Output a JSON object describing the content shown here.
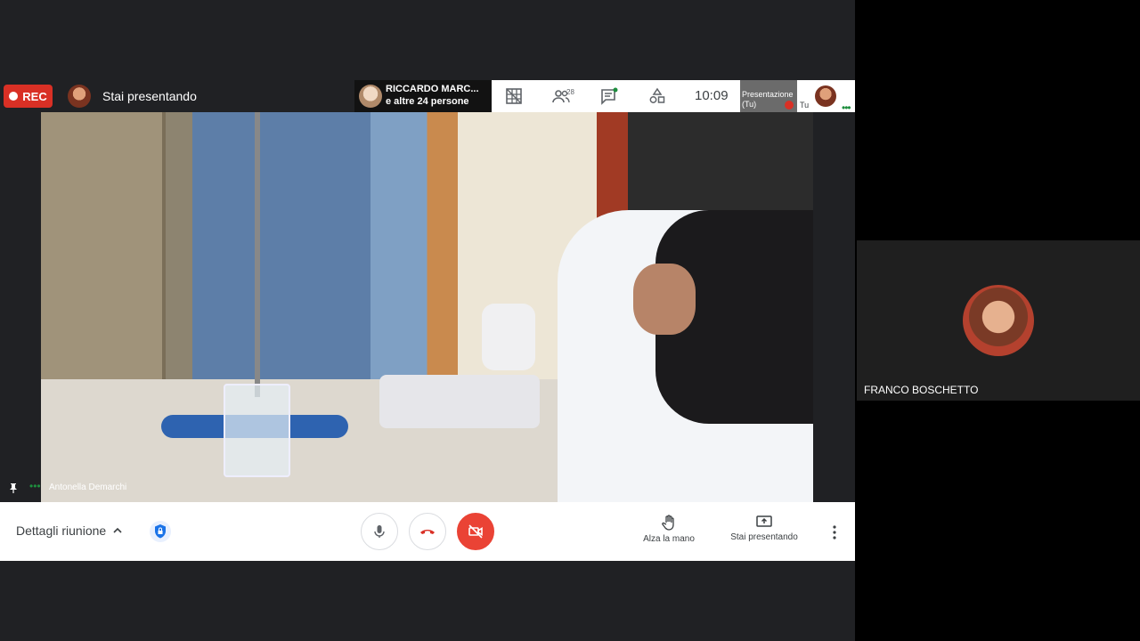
{
  "topbar": {
    "rec_label": "REC",
    "presenting_label": "Stai presentando",
    "presenter": {
      "name": "RICCARDO MARC...",
      "others": "e altre 24 persone"
    },
    "participants_count": "28",
    "clock": "10:09",
    "self_thumb": {
      "line1": "Presentazione",
      "line2": "(Tu)"
    },
    "self_label": "Tu"
  },
  "video": {
    "speaker_name": "Antonella Demarchi"
  },
  "bottombar": {
    "details_label": "Dettagli riunione",
    "raise_hand_label": "Alza la mano",
    "presenting_label": "Stai presentando"
  },
  "side_tile": {
    "name": "FRANCO BOSCHETTO"
  },
  "colors": {
    "rec_red": "#d93025",
    "end_call_red": "#ea4335",
    "active_green": "#1e8e3e",
    "shield_blue": "#1a73e8"
  }
}
